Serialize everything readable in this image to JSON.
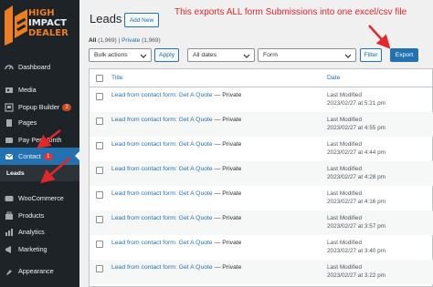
{
  "logo": {
    "line1": "HIGH",
    "line2": "IMPACT",
    "line3": "DEALER"
  },
  "sidebar": {
    "items": [
      {
        "label": "Dashboard",
        "icon": "dashboard-icon"
      },
      {
        "label": "Media",
        "icon": "media-icon"
      },
      {
        "label": "Popup Builder",
        "icon": "popup-icon",
        "badge": "2"
      },
      {
        "label": "Pages",
        "icon": "pages-icon"
      },
      {
        "label": "Pay Per Month",
        "icon": "pay-icon"
      },
      {
        "label": "Contact",
        "icon": "mail-icon",
        "badge": "1"
      },
      {
        "label": "WooCommerce",
        "icon": "woo-icon"
      },
      {
        "label": "Products",
        "icon": "products-icon"
      },
      {
        "label": "Analytics",
        "icon": "analytics-icon"
      },
      {
        "label": "Marketing",
        "icon": "marketing-icon"
      },
      {
        "label": "Appearance",
        "icon": "appearance-icon"
      }
    ],
    "submenu": {
      "label": "Leads"
    }
  },
  "header": {
    "title": "Leads",
    "add_new": "Add New"
  },
  "annotation": "This exports ALL form Submissions into one excel/csv file",
  "filters": {
    "all": "All",
    "all_count": "(1,969)",
    "sep": "|",
    "private": "Private",
    "private_count": "(1,969)"
  },
  "toolbar": {
    "bulk": "Bulk actions",
    "apply": "Apply",
    "dates": "All dates",
    "form": "Form",
    "filter": "Filter",
    "export": "Export"
  },
  "table": {
    "columns": [
      "Title",
      "Date"
    ],
    "rows": [
      {
        "title": "Lead from contact form: Get A Quote",
        "status": " — Private",
        "d1": "Last Modified",
        "d2": "2023/02/27 at 5:21 pm"
      },
      {
        "title": "Lead from contact form: Get A Quote",
        "status": " — Private",
        "d1": "Last Modified",
        "d2": "2023/02/27 at 4:55 pm"
      },
      {
        "title": "Lead from contact form: Get A Quote",
        "status": " — Private",
        "d1": "Last Modified",
        "d2": "2023/02/27 at 4:44 pm"
      },
      {
        "title": "Lead from contact form: Get A Quote",
        "status": " — Private",
        "d1": "Last Modified",
        "d2": "2023/02/27 at 4:28 pm"
      },
      {
        "title": "Lead from contact form: Get A Quote",
        "status": " — Private",
        "d1": "Last Modified",
        "d2": "2023/02/27 at 4:16 pm"
      },
      {
        "title": "Lead from contact form: Get A Quote",
        "status": " — Private",
        "d1": "Last Modified",
        "d2": "2023/02/27 at 3:57 pm"
      },
      {
        "title": "Lead from contact form: Get A Quote",
        "status": " — Private",
        "d1": "Last Modified",
        "d2": "2023/02/27 at 3:40 pm"
      },
      {
        "title": "Lead from contact form: Get A Quote",
        "status": " — Private",
        "d1": "Last Modified",
        "d2": "2023/02/27 at 3:22 pm"
      }
    ]
  },
  "colors": {
    "accent": "#2271b1",
    "sidebar": "#1d2327",
    "annotation": "#e3262b",
    "logo": "#ef7d22"
  }
}
